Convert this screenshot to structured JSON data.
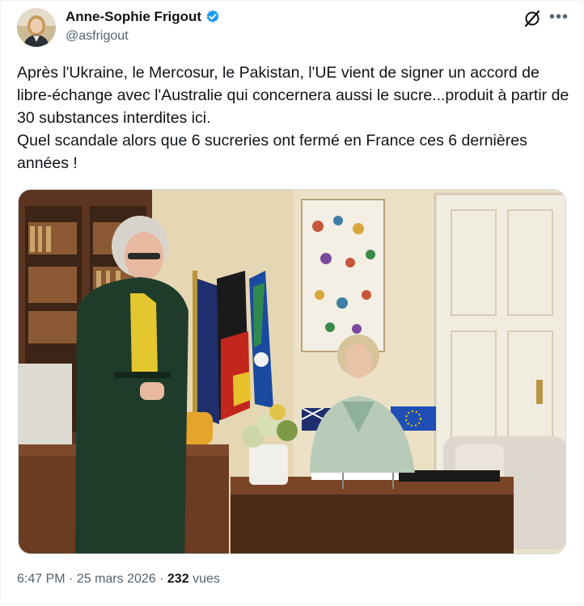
{
  "author": {
    "name": "Anne-Sophie Frigout",
    "handle": "@asfrigout"
  },
  "tweet": {
    "lines": [
      "Après l'Ukraine, le Mercosur, le Pakistan, l'UE vient de signer un accord de libre-échange avec l'Australie qui concernera aussi le sucre...produit à partir de 30 substances interdites ici.",
      "Quel scandale alors que 6 sucreries ont fermé en France ces 6 dernières années !"
    ]
  },
  "meta": {
    "time": "6:47 PM",
    "separator": "·",
    "date": "25 mars 2026",
    "views_count": "232",
    "views_label": "vues"
  },
  "icons": {
    "verified": "verified-badge-icon",
    "grok": "grok-icon",
    "more": "more-options-icon"
  },
  "colors": {
    "verified_blue": "#1d9bf0",
    "secondary_text": "#536471",
    "primary_text": "#0f1419",
    "eu_blue": "#1f4fb5"
  }
}
